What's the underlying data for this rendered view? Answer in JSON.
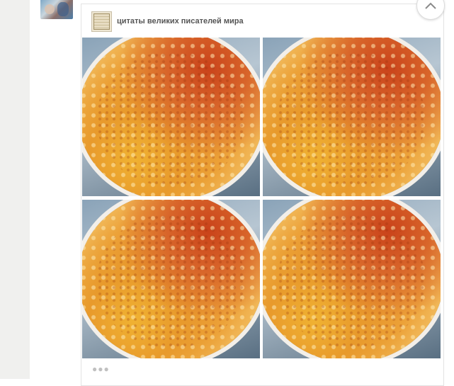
{
  "group": {
    "name": "цитаты великих писателей мира",
    "logo_icon": "book-cover-logo"
  },
  "photos": [
    {
      "alt_icon": "pancake-photo"
    },
    {
      "alt_icon": "pancake-photo"
    },
    {
      "alt_icon": "pancake-photo"
    },
    {
      "alt_icon": "pancake-photo"
    }
  ],
  "actions": {
    "collapse_icon": "chevron-up-icon",
    "more_icon": "more-dots-icon"
  },
  "colors": {
    "page_strip": "#f0f0ee",
    "card_border": "#e3e3e3",
    "group_name": "#555555"
  }
}
